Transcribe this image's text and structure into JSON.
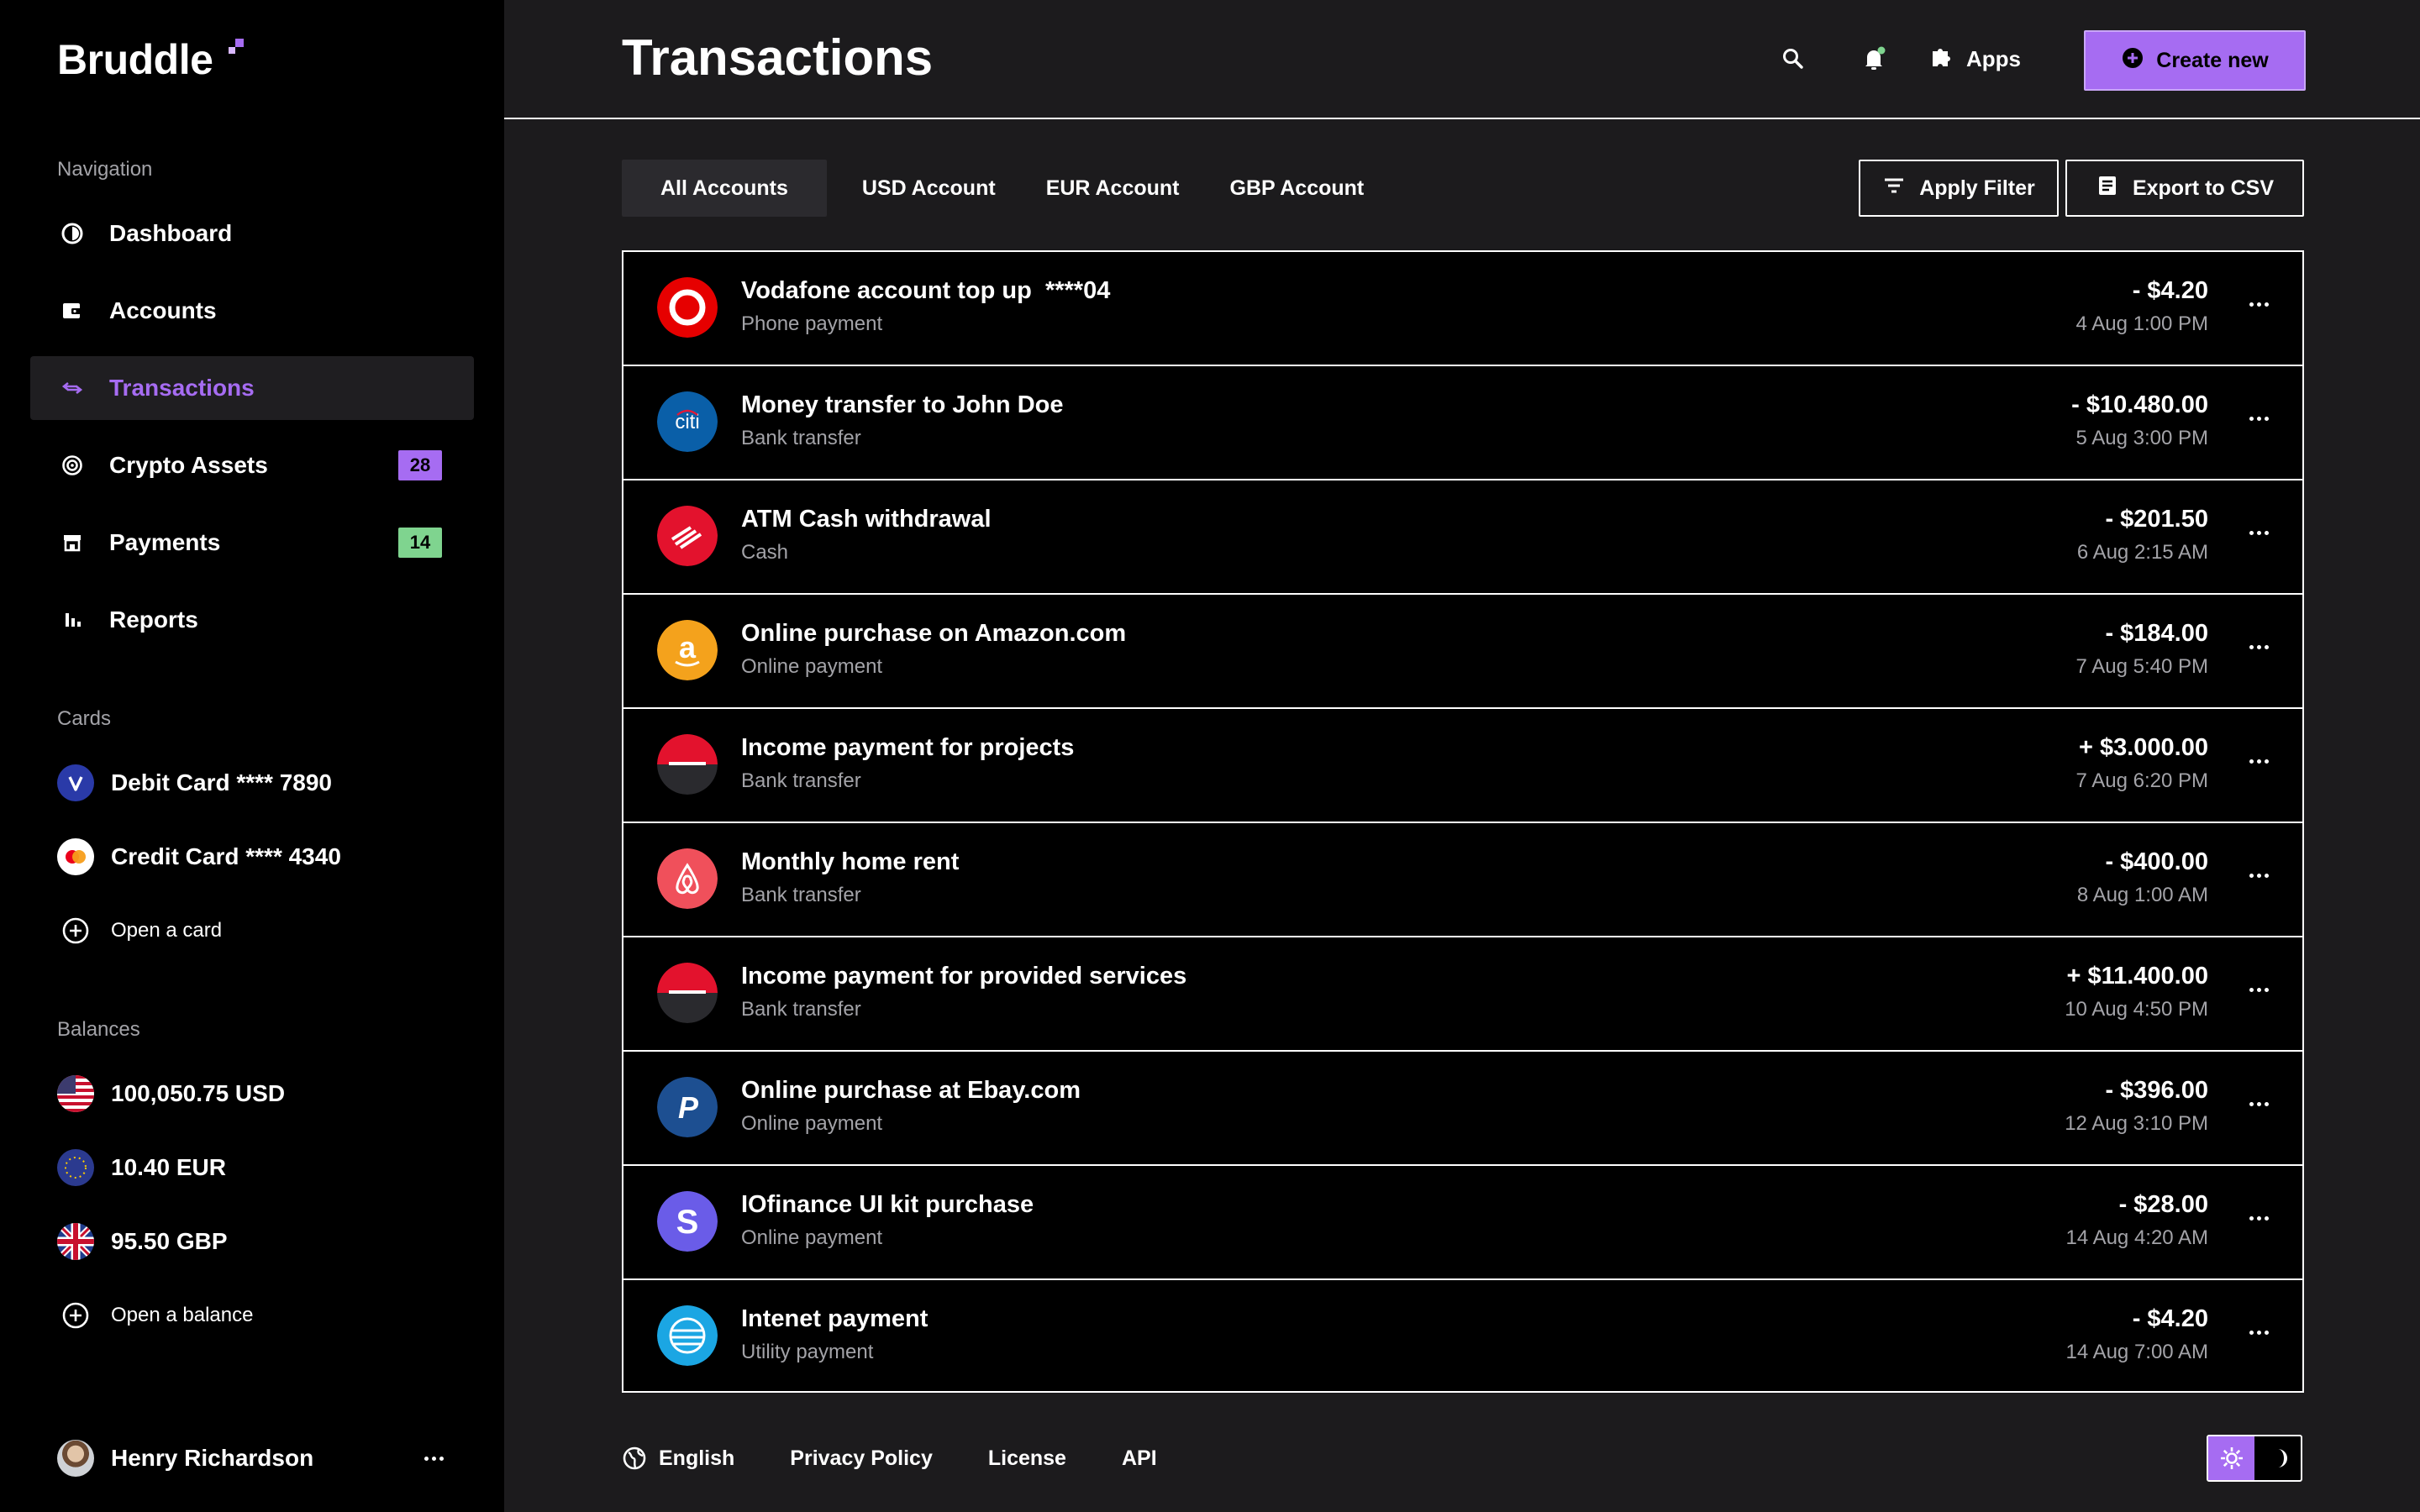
{
  "brand": {
    "name": "Bruddle",
    "accent": "#a66cf2"
  },
  "sidebar": {
    "nav_label": "Navigation",
    "nav": [
      {
        "label": "Dashboard",
        "icon": "dashboard-icon"
      },
      {
        "label": "Accounts",
        "icon": "wallet-icon"
      },
      {
        "label": "Transactions",
        "icon": "transfer-arrows-icon",
        "active": true
      },
      {
        "label": "Crypto Assets",
        "icon": "crypto-icon",
        "badge": "28",
        "badge_color": "#a66cf2"
      },
      {
        "label": "Payments",
        "icon": "store-icon",
        "badge": "14",
        "badge_color": "#7fd48f"
      },
      {
        "label": "Reports",
        "icon": "bar-chart-icon"
      }
    ],
    "cards_label": "Cards",
    "cards": [
      {
        "label": "Debit Card **** 7890",
        "icon": "visa-icon"
      },
      {
        "label": "Credit Card **** 4340",
        "icon": "mastercard-icon"
      }
    ],
    "open_card": "Open a card",
    "balances_label": "Balances",
    "balances": [
      {
        "label": "100,050.75 USD",
        "icon": "us-flag-icon"
      },
      {
        "label": "10.40 EUR",
        "icon": "eu-flag-icon"
      },
      {
        "label": "95.50 GBP",
        "icon": "uk-flag-icon"
      }
    ],
    "open_balance": "Open a balance",
    "user": {
      "name": "Henry Richardson"
    }
  },
  "header": {
    "title": "Transactions",
    "apps_label": "Apps",
    "create_label": "Create new"
  },
  "tabs": [
    "All Accounts",
    "USD Account",
    "EUR Account",
    "GBP Account"
  ],
  "actions": {
    "filter_label": "Apply Filter",
    "export_label": "Export to CSV"
  },
  "transactions": [
    {
      "title": "Vodafone account top up  ****04",
      "type": "Phone payment",
      "amount": "- $4.20",
      "date": "4 Aug 1:00 PM",
      "logo": "vodafone-logo-icon"
    },
    {
      "title": "Money transfer to John Doe",
      "type": "Bank transfer",
      "amount": "- $10.480.00",
      "date": "5 Aug 3:00 PM",
      "logo": "citi-logo-icon"
    },
    {
      "title": "ATM Cash withdrawal",
      "type": "Cash",
      "amount": "- $201.50",
      "date": "6 Aug 2:15 AM",
      "logo": "bank-of-america-logo-icon"
    },
    {
      "title": "Online purchase on Amazon.com",
      "type": "Online payment",
      "amount": "- $184.00",
      "date": "7 Aug 5:40 PM",
      "logo": "amazon-logo-icon"
    },
    {
      "title": "Income payment for projects",
      "type": "Bank transfer",
      "amount": "+ $3.000.00",
      "date": "7 Aug 6:20 PM",
      "logo": "bank-logo-icon"
    },
    {
      "title": "Monthly home rent",
      "type": "Bank transfer",
      "amount": "- $400.00",
      "date": "8 Aug 1:00 AM",
      "logo": "airbnb-logo-icon"
    },
    {
      "title": "Income payment for provided services",
      "type": "Bank transfer",
      "amount": "+ $11.400.00",
      "date": "10 Aug 4:50 PM",
      "logo": "bank-logo-icon"
    },
    {
      "title": "Online purchase at Ebay.com",
      "type": "Online payment",
      "amount": "- $396.00",
      "date": "12 Aug 3:10 PM",
      "logo": "paypal-logo-icon"
    },
    {
      "title": "IOfinance UI kit purchase",
      "type": "Online payment",
      "amount": "- $28.00",
      "date": "14 Aug 4:20 AM",
      "logo": "stripe-logo-icon"
    },
    {
      "title": "Intenet payment",
      "type": "Utility payment",
      "amount": "- $4.20",
      "date": "14 Aug 7:00 AM",
      "logo": "att-logo-icon"
    }
  ],
  "footer": {
    "language": "English",
    "links": [
      "Privacy Policy",
      "License",
      "API"
    ]
  }
}
